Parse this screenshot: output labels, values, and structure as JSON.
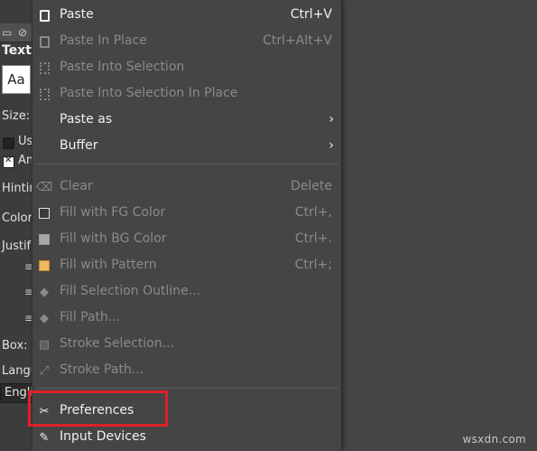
{
  "panel": {
    "title": "Text",
    "font_preview": "Aa",
    "size_label": "Size:",
    "use_editor_label": "Us",
    "antialiasing_label": "An",
    "hinting_label": "Hintin",
    "color_label": "Color",
    "justify_label": "Justif",
    "box_label": "Box:",
    "language_label": "Langu",
    "language_value": "Engli"
  },
  "menu": {
    "items": [
      {
        "label": "Paste",
        "shortcut": "Ctrl+V",
        "enabled": true,
        "icon": "clipboard-icon"
      },
      {
        "label": "Paste In Place",
        "shortcut": "Ctrl+Alt+V",
        "enabled": false,
        "icon": "clipboard-icon"
      },
      {
        "label": "Paste Into Selection",
        "shortcut": "",
        "enabled": false,
        "icon": "paste-selection-icon"
      },
      {
        "label": "Paste Into Selection In Place",
        "shortcut": "",
        "enabled": false,
        "icon": "paste-selection-icon"
      },
      {
        "label": "Paste as",
        "shortcut": "",
        "enabled": true,
        "submenu": true
      },
      {
        "label": "Buffer",
        "shortcut": "",
        "enabled": true,
        "submenu": true
      },
      {
        "label": "Clear",
        "shortcut": "Delete",
        "enabled": false,
        "icon": "erase-icon"
      },
      {
        "label": "Fill with FG Color",
        "shortcut": "Ctrl+,",
        "enabled": false,
        "icon": "fg-color-icon"
      },
      {
        "label": "Fill with BG Color",
        "shortcut": "Ctrl+.",
        "enabled": false,
        "icon": "bg-color-icon"
      },
      {
        "label": "Fill with Pattern",
        "shortcut": "Ctrl+;",
        "enabled": false,
        "icon": "pattern-icon"
      },
      {
        "label": "Fill Selection Outline...",
        "shortcut": "",
        "enabled": false,
        "icon": "bucket-icon"
      },
      {
        "label": "Fill Path...",
        "shortcut": "",
        "enabled": false,
        "icon": "bucket-icon"
      },
      {
        "label": "Stroke Selection...",
        "shortcut": "",
        "enabled": false,
        "icon": "stroke-selection-icon"
      },
      {
        "label": "Stroke Path...",
        "shortcut": "",
        "enabled": false,
        "icon": "stroke-path-icon"
      },
      {
        "label": "Preferences",
        "shortcut": "",
        "enabled": true,
        "icon": "preferences-icon"
      },
      {
        "label": "Input Devices",
        "shortcut": "",
        "enabled": true,
        "icon": "input-devices-icon"
      }
    ],
    "submenu_arrow": "›"
  },
  "watermark": "wsxdn.com",
  "colors": {
    "background": "#454545",
    "highlight": "#e0202a",
    "disabled_text": "#8a8a8a",
    "enabled_text": "#f0f0f0"
  }
}
